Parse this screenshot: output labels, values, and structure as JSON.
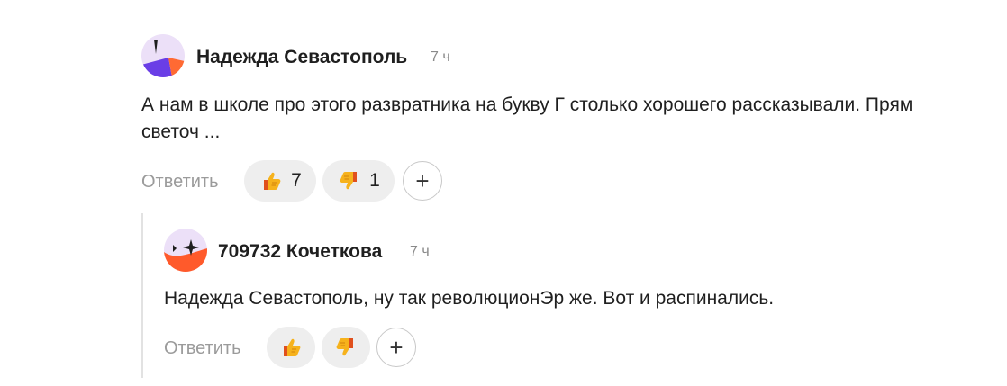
{
  "comments": [
    {
      "author": "Надежда Севастополь",
      "time": "7 ч",
      "text": "А нам в школе про этого развратника на букву Г столько хорошего рассказывали. Прям светоч ...",
      "reply_label": "Ответить",
      "likes": "7",
      "dislikes": "1",
      "avatar_colors": [
        "#e9ddf7",
        "#6a3ee6",
        "#ff5a2b",
        "#1f1f1f"
      ]
    },
    {
      "author": "709732 Кочеткова",
      "time": "7 ч",
      "text": "Надежда Севастополь, ну так революционЭр же. Вот и распинались.",
      "reply_label": "Ответить",
      "avatar_colors": [
        "#e9ddf7",
        "#ff5a2b",
        "#1f1f1f"
      ]
    }
  ],
  "icons": {
    "like": "thumbs-up-icon",
    "dislike": "thumbs-down-icon",
    "add_reaction": "plus-icon"
  }
}
